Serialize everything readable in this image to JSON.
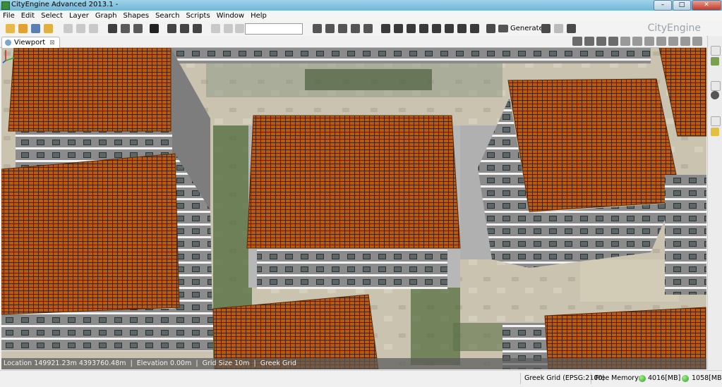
{
  "window": {
    "title": "CityEngine Advanced 2013.1 -",
    "min": "–",
    "max": "□",
    "close": "✕"
  },
  "menu": [
    "File",
    "Edit",
    "Select",
    "Layer",
    "Graph",
    "Shapes",
    "Search",
    "Scripts",
    "Window",
    "Help"
  ],
  "toolbar": {
    "search_value": "",
    "generate_label": "Generate",
    "brand": "CityEngine"
  },
  "viewport": {
    "tab_label": "Viewport",
    "tab_close": "⊠",
    "status": {
      "location": "Location 149921.23m 4393760.48m",
      "elevation": "Elevation 0.00m",
      "grid_size": "Grid Size 10m",
      "grid_name": "Greek Grid",
      "sep": "|"
    }
  },
  "statusbar": {
    "crs": "Greek Grid (EPSG:2100)",
    "free_memory_label": "Free Memory:",
    "mem1": "4016[MB]",
    "mem2": "1058[MB]"
  },
  "colors": {
    "roof": "#b85a10",
    "roof_line": "#4a1f04",
    "facade": "#8b8b8b",
    "ground": "#c9c3b0",
    "green": "#4f6a3a"
  }
}
